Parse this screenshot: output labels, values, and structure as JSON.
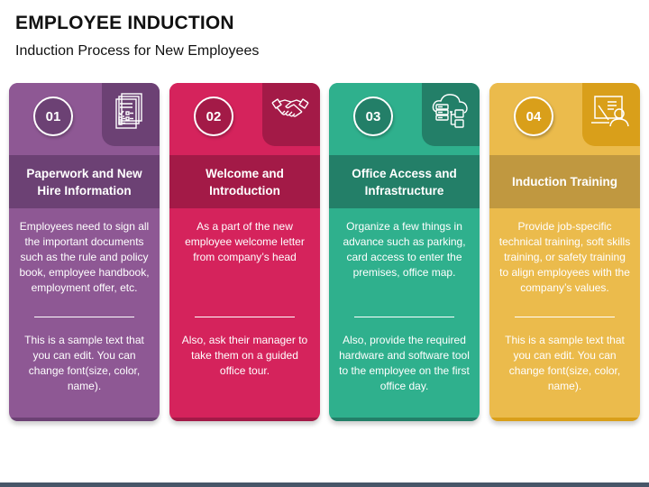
{
  "header": {
    "title": "EMPLOYEE INDUCTION",
    "subtitle": "Induction Process for New Employees"
  },
  "cards": [
    {
      "number": "01",
      "icon": "checklist-document-icon",
      "title": "Paperwork and New Hire Information",
      "paragraph1": "Employees need to sign all the important documents such as the rule and policy book, employee handbook, employment offer, etc.",
      "paragraph2": "This is a sample text that you can edit. You can change font(size, color, name).",
      "colors": {
        "light": "#8e5894",
        "dark": "#6c4174"
      }
    },
    {
      "number": "02",
      "icon": "handshake-icon",
      "title": "Welcome and Introduction",
      "paragraph1": "As a part of the new employee welcome letter from company’s head",
      "paragraph2": "Also, ask their manager to take them on a guided office tour.",
      "colors": {
        "light": "#d5235c",
        "dark": "#a31a47"
      }
    },
    {
      "number": "03",
      "icon": "cloud-server-icon",
      "title": "Office Access and Infrastructure",
      "paragraph1": "Organize a few things in advance such as parking, card access to enter the premises, office map.",
      "paragraph2": "Also, provide the required hardware and software tool to the employee on the first office day.",
      "colors": {
        "light": "#2fb08d",
        "dark": "#237f68"
      }
    },
    {
      "number": "04",
      "icon": "training-presentation-icon",
      "title": "Induction Training",
      "paragraph1": "Provide job-specific technical training, soft skills training, or safety training to align employees with the company’s values.",
      "paragraph2": "This is a sample text that you can edit. You can change font(size, color, name).",
      "colors": {
        "light": "#ebbb4c",
        "dark": "#d99f1a",
        "band": "#c09840"
      }
    }
  ]
}
